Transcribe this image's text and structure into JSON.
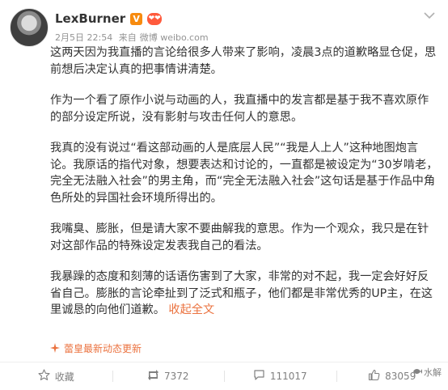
{
  "post": {
    "username": "LexBurner",
    "vip_badge": "V",
    "medal_badge": "❤❤",
    "timestamp": "2月5日 22:54",
    "source_prefix": "来自",
    "source": "微博 weibo.com",
    "paragraphs": [
      "这两天因为我直播的言论给很多人带来了影响，凌晨3点的道歉略显仓促，思前想后决定认真的把事情讲清楚。",
      "作为一个看了原作小说与动画的人，我直播中的发言都是基于我不喜欢原作的部分设定所说，没有影射与攻击任何人的意思。",
      "我真的没有说过“看这部动画的人是底层人民”“我是人上人”这种地图炮言论。我原话的指代对象，想要表达和讨论的，一直都是被设定为“30岁啃老，完全无法融入社会”的男主角，而“完全无法融入社会”这句话是基于作品中角色所处的异国社会环境所得出的。",
      "我嘴臭、膨胀，但是请大家不要曲解我的意思。作为一个观众，我只是在针对这部作品的特殊设定发表我自己的看法。"
    ],
    "last_paragraph": "我暴躁的态度和刻薄的话语伤害到了大家，非常的对不起，我一定会好好反省自己。膨胀的言论牵扯到了泛式和瓶子，他们都是非常优秀的UP主，在这里诚恳的向他们道歉。",
    "collapse_link": "收起全文",
    "tip": "蕾皇最新动态更新"
  },
  "actions": {
    "favorite_label": "收藏",
    "repost_count": "7372",
    "comment_count": "111017",
    "like_count": "83059"
  },
  "watermark": "水解",
  "colors": {
    "link_orange": "#eb7340",
    "vip_orange": "#f78b0f",
    "meta_gray": "#939393"
  }
}
